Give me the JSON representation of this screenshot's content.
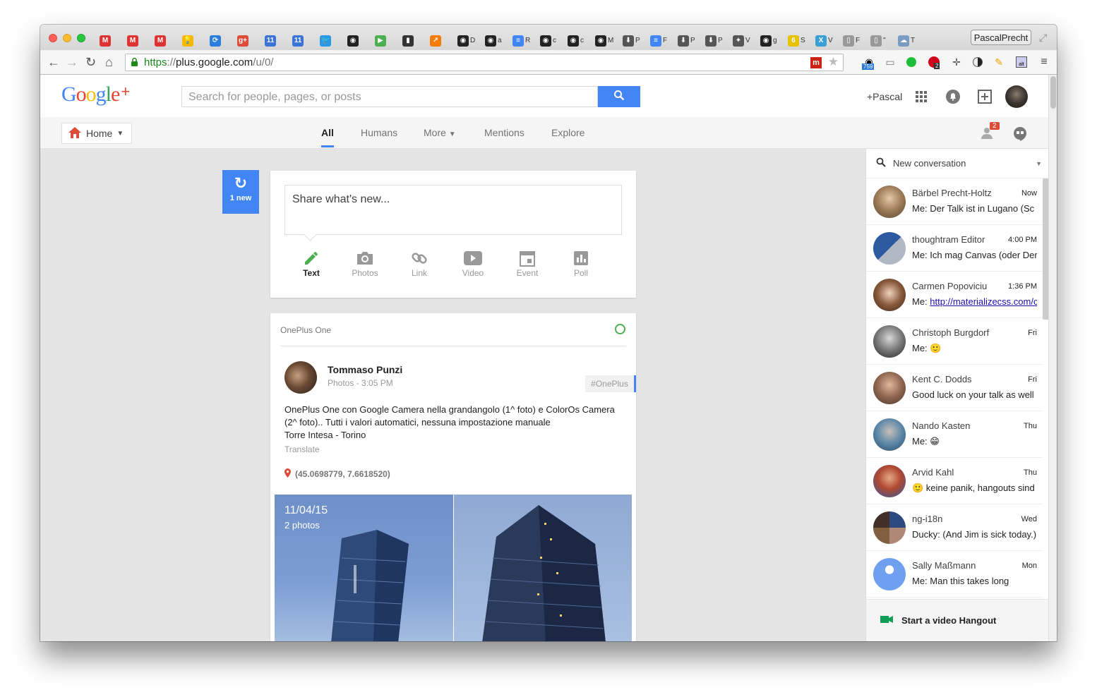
{
  "browser": {
    "tabs": [
      {
        "icon": "gmail-icon",
        "glyph": "M",
        "color": "#d33",
        "text": ""
      },
      {
        "icon": "gmail-icon",
        "glyph": "M",
        "color": "#d33",
        "text": ""
      },
      {
        "icon": "gmail-icon",
        "glyph": "M",
        "color": "#d33",
        "text": ""
      },
      {
        "icon": "keep-icon",
        "glyph": "💡",
        "color": "#f6b800",
        "text": ""
      },
      {
        "icon": "app-icon",
        "glyph": "⟳",
        "color": "#2b7de0",
        "text": ""
      },
      {
        "icon": "google-plus-icon",
        "glyph": "g+",
        "color": "#dd4b39",
        "text": ""
      },
      {
        "icon": "calendar-icon",
        "glyph": "11",
        "color": "#3b73d6",
        "text": ""
      },
      {
        "icon": "calendar-icon",
        "glyph": "11",
        "color": "#3b73d6",
        "text": ""
      },
      {
        "icon": "twitter-icon",
        "glyph": "🐦",
        "color": "#2a9ae5",
        "text": ""
      },
      {
        "icon": "github-icon",
        "glyph": "◉",
        "color": "#222",
        "text": ""
      },
      {
        "icon": "play-icon",
        "glyph": "▶",
        "color": "#4caf50",
        "text": ""
      },
      {
        "icon": "app-icon",
        "glyph": "▮",
        "color": "#333",
        "text": ""
      },
      {
        "icon": "chart-icon",
        "glyph": "↗",
        "color": "#f57c00",
        "text": ""
      },
      {
        "icon": "github-icon",
        "glyph": "◉",
        "color": "#222",
        "text": "D"
      },
      {
        "icon": "github-icon",
        "glyph": "◉",
        "color": "#222",
        "text": "a"
      },
      {
        "icon": "docs-icon",
        "glyph": "≡",
        "color": "#4285f4",
        "text": "R"
      },
      {
        "icon": "github-icon",
        "glyph": "◉",
        "color": "#222",
        "text": "c"
      },
      {
        "icon": "github-icon",
        "glyph": "◉",
        "color": "#222",
        "text": "c"
      },
      {
        "icon": "github-icon",
        "glyph": "◉",
        "color": "#222",
        "text": "M"
      },
      {
        "icon": "download-icon",
        "glyph": "⬇",
        "color": "#555",
        "text": "P"
      },
      {
        "icon": "docs-icon",
        "glyph": "≡",
        "color": "#4285f4",
        "text": "F"
      },
      {
        "icon": "download-icon",
        "glyph": "⬇",
        "color": "#555",
        "text": "P"
      },
      {
        "icon": "download-icon",
        "glyph": "⬇",
        "color": "#555",
        "text": "P"
      },
      {
        "icon": "app-icon",
        "glyph": "✦",
        "color": "#555",
        "text": "V"
      },
      {
        "icon": "github-icon",
        "glyph": "◉",
        "color": "#222",
        "text": "g"
      },
      {
        "icon": "app-icon",
        "glyph": "6",
        "color": "#e6c200",
        "text": "S"
      },
      {
        "icon": "app-icon",
        "glyph": "X",
        "color": "#3aa0d8",
        "text": "V"
      },
      {
        "icon": "page-icon",
        "glyph": "▯",
        "color": "#999",
        "text": "F"
      },
      {
        "icon": "page-icon",
        "glyph": "▯",
        "color": "#999",
        "text": "\""
      },
      {
        "icon": "app-icon",
        "glyph": "☁",
        "color": "#7a9cc0",
        "text": "T"
      }
    ],
    "profile_name": "PascalPrecht",
    "url_scheme": "https",
    "url_sep": "://",
    "url_host": "plus.google.com",
    "url_path": "/u/0/",
    "ext_badge_1": "759",
    "ext_badge_2": "2"
  },
  "gplus": {
    "logo_google": "Google",
    "logo_plus": "+",
    "search_placeholder": "Search for people, pages, or posts",
    "user_label": "+Pascal",
    "home_label": "Home",
    "nav_tabs": [
      "All",
      "Humans",
      "More",
      "Mentions",
      "Explore"
    ],
    "notif_count": "2",
    "new_button": "1 new",
    "share_placeholder": "Share what's new...",
    "share_options": [
      "Text",
      "Photos",
      "Link",
      "Video",
      "Event",
      "Poll"
    ],
    "post": {
      "community": "OnePlus One",
      "author": "Tommaso Punzi",
      "meta": "Photos  -  3:05 PM",
      "tag": "#OnePlus",
      "text_lines": [
        "OnePlus One con Google Camera nella grandangolo (1^ foto) e ColorOs Camera",
        "(2^ foto).. Tutti i valori automatici, nessuna impostazione manuale",
        "Torre Intesa - Torino"
      ],
      "translate": "Translate",
      "location": "(45.0698779, 7.6618520)",
      "album_date": "11/04/15",
      "album_count": "2 photos"
    }
  },
  "hangouts": {
    "new_conversation": "New conversation",
    "items": [
      {
        "name": "Bärbel Precht-Holtz",
        "time": "Now",
        "message": "Me: Der Talk ist in Lugano (Sc",
        "link": ""
      },
      {
        "name": "thoughtram Editor",
        "time": "4:00 PM",
        "message": "Me: Ich mag Canvas (oder Der",
        "link": ""
      },
      {
        "name": "Carmen Popoviciu",
        "time": "1:36 PM",
        "message": "Me: ",
        "link": "http://materializecss.com/c"
      },
      {
        "name": "Christoph Burgdorf",
        "time": "Fri",
        "message": "Me: 🙂",
        "link": ""
      },
      {
        "name": "Kent C. Dodds",
        "time": "Fri",
        "message": "Good luck on your talk as well",
        "link": ""
      },
      {
        "name": "Nando Kasten",
        "time": "Thu",
        "message": "Me: 😁",
        "link": ""
      },
      {
        "name": "Arvid Kahl",
        "time": "Thu",
        "message": "🙂 keine panik, hangouts sind",
        "link": ""
      },
      {
        "name": "ng-i18n",
        "time": "Wed",
        "message": "Ducky: (And Jim is sick today.)",
        "link": ""
      },
      {
        "name": "Sally Maßmann",
        "time": "Mon",
        "message": "Me: Man this takes long",
        "link": ""
      }
    ],
    "video_hangout": "Start a video Hangout"
  },
  "colors": {
    "accent": "#4285f4",
    "gplus_red": "#dd4b39",
    "share_green": "#4caf50",
    "hangout_green": "#0f9d58"
  }
}
